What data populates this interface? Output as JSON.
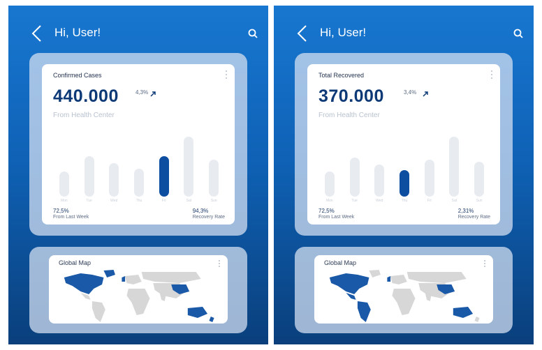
{
  "colors": {
    "accent": "#0d4ea1",
    "bar_inactive": "#e8ebf0",
    "gradient_top": "#1877d0",
    "gradient_bottom": "#0a3f7c",
    "country_highlight": "#1a58a8",
    "country_base": "#d7d7d7"
  },
  "icons": {
    "back": "chevron-left-icon",
    "search": "search-icon",
    "more": "more-vertical-icon",
    "trend": "arrow-up-right-icon"
  },
  "screens": [
    {
      "header": {
        "greeting": "Hi, User!"
      },
      "stats_card": {
        "title": "Confirmed Cases",
        "value": "440.000",
        "percent": "4,3%",
        "subtitle": "From Health Center",
        "days": [
          "Mon",
          "Tue",
          "Wed",
          "Thu",
          "Fri",
          "Sat",
          "Sun"
        ],
        "bar_values": [
          0.38,
          0.6,
          0.5,
          0.42,
          0.6,
          0.9,
          0.55
        ],
        "highlight_index": 4,
        "left_stat": {
          "value": "72,5%",
          "label": "From Last Week"
        },
        "right_stat": {
          "value": "94,3%",
          "label": "Recovery Rate"
        }
      },
      "map_card": {
        "title": "Global Map"
      }
    },
    {
      "header": {
        "greeting": "Hi, User!"
      },
      "stats_card": {
        "title": "Total Recovered",
        "value": "370.000",
        "percent": "3,4%",
        "subtitle": "From Health Center",
        "days": [
          "Mon",
          "Tue",
          "Wed",
          "Thu",
          "Fri",
          "Sat",
          "Sun"
        ],
        "bar_values": [
          0.38,
          0.58,
          0.48,
          0.4,
          0.55,
          0.9,
          0.52
        ],
        "highlight_index": 3,
        "left_stat": {
          "value": "72,5%",
          "label": "From Last Week"
        },
        "right_stat": {
          "value": "2,31%",
          "label": "Recovery Rate"
        }
      },
      "map_card": {
        "title": "Global Map"
      }
    }
  ]
}
